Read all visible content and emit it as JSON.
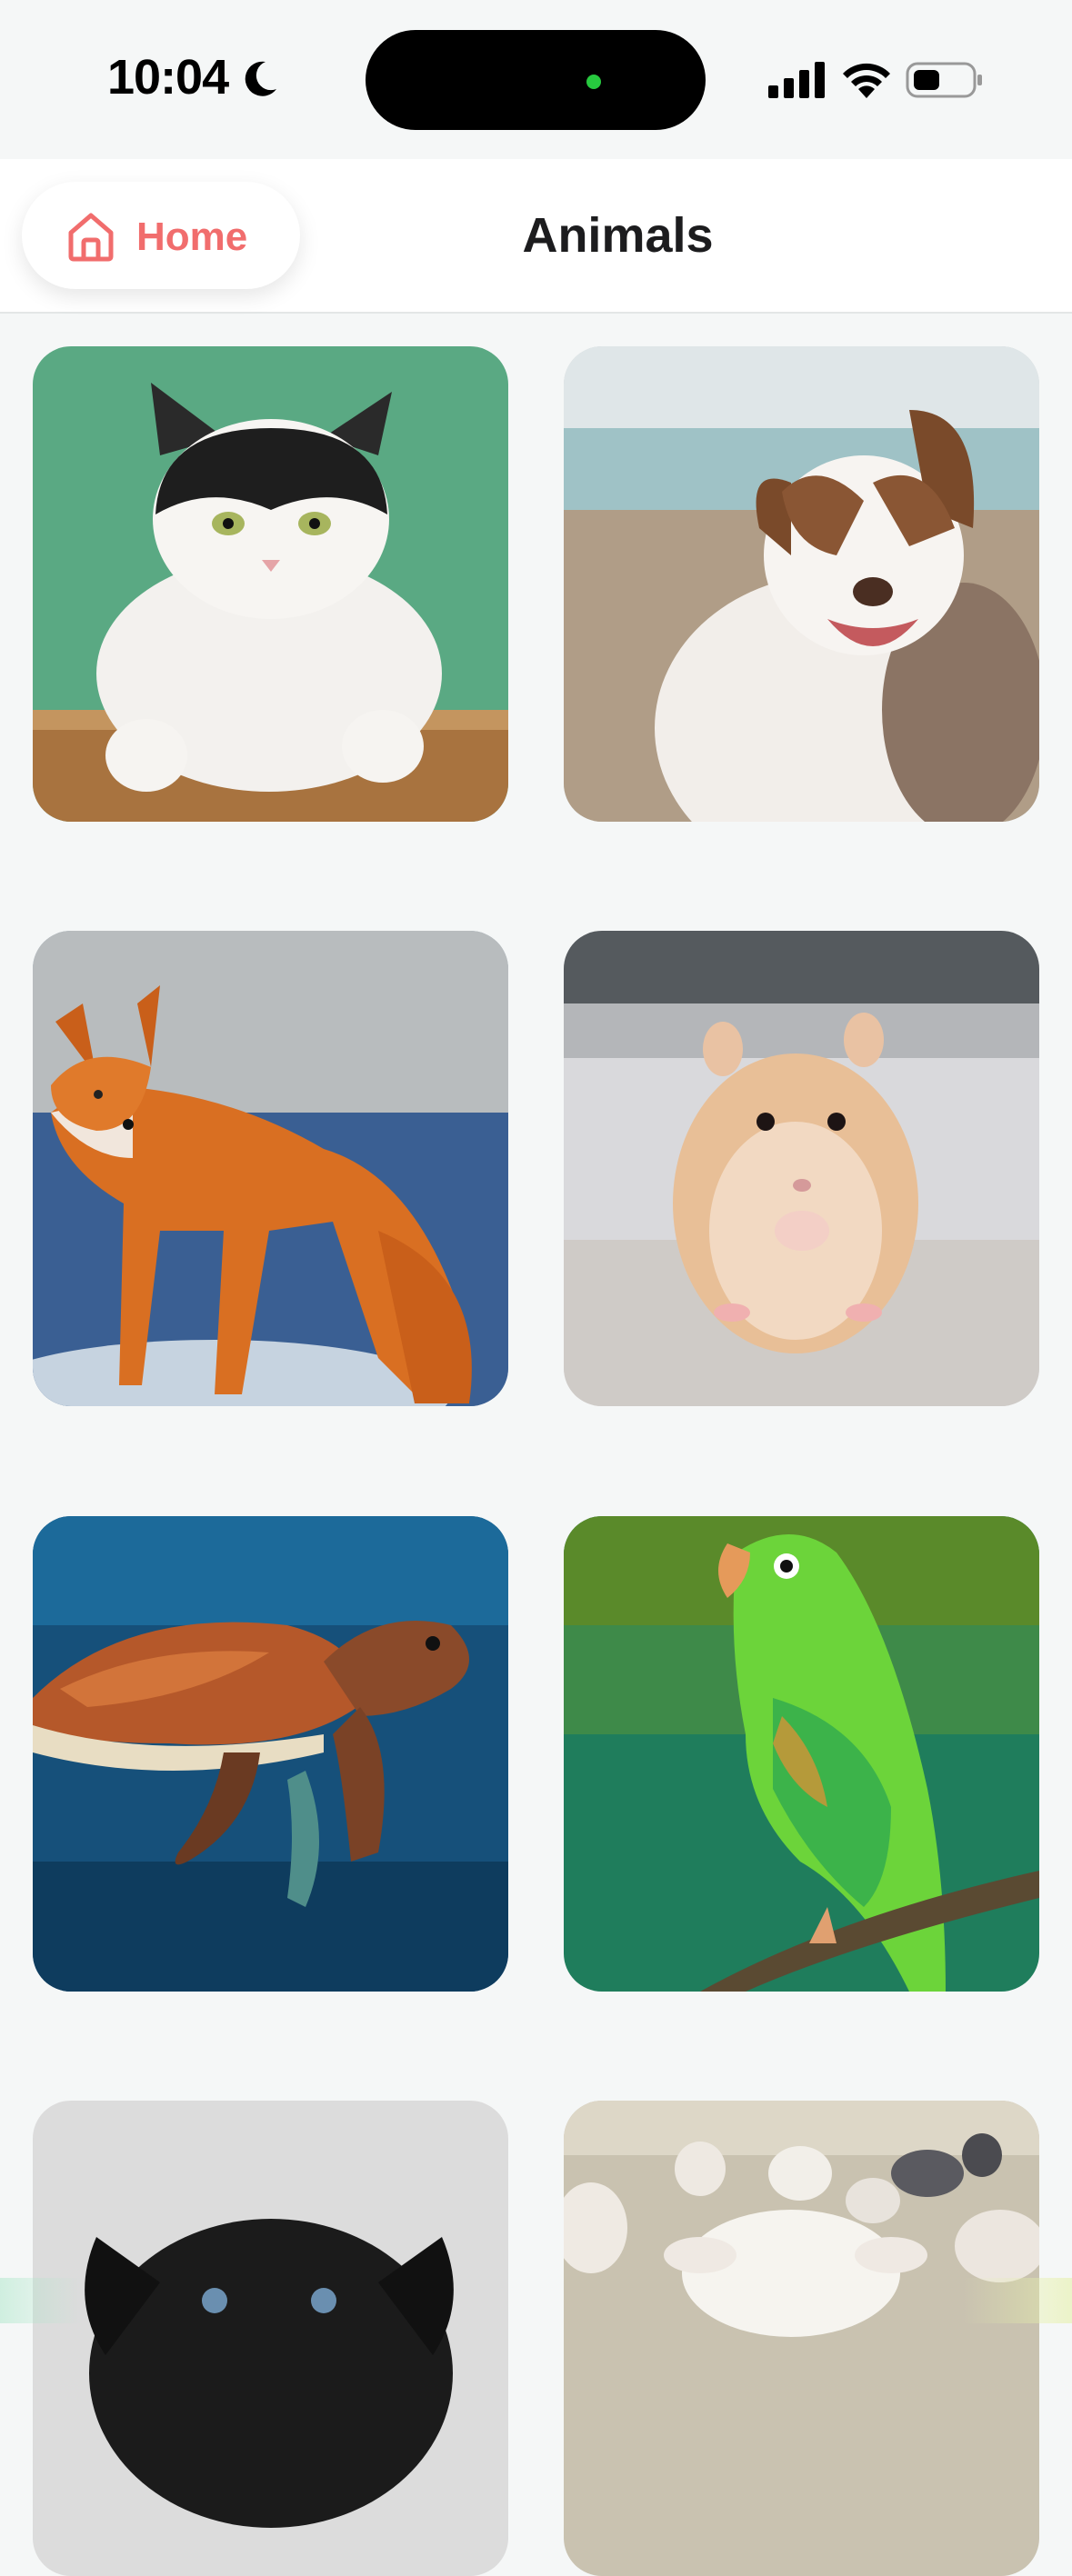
{
  "status_bar": {
    "time": "10:04",
    "icons": [
      "moon-icon",
      "cellular-signal-icon",
      "wifi-icon",
      "battery-icon"
    ]
  },
  "nav": {
    "home_label": "Home",
    "home_icon": "house-icon",
    "title": "Animals"
  },
  "colors": {
    "accent": "#f16d6d",
    "background": "#f5f7f7",
    "title": "#1c1c1e"
  },
  "animals": [
    {
      "name": "cat"
    },
    {
      "name": "dog"
    },
    {
      "name": "fox"
    },
    {
      "name": "hamster"
    },
    {
      "name": "turtle"
    },
    {
      "name": "parrot"
    },
    {
      "name": "puppy"
    },
    {
      "name": "sheep"
    }
  ]
}
